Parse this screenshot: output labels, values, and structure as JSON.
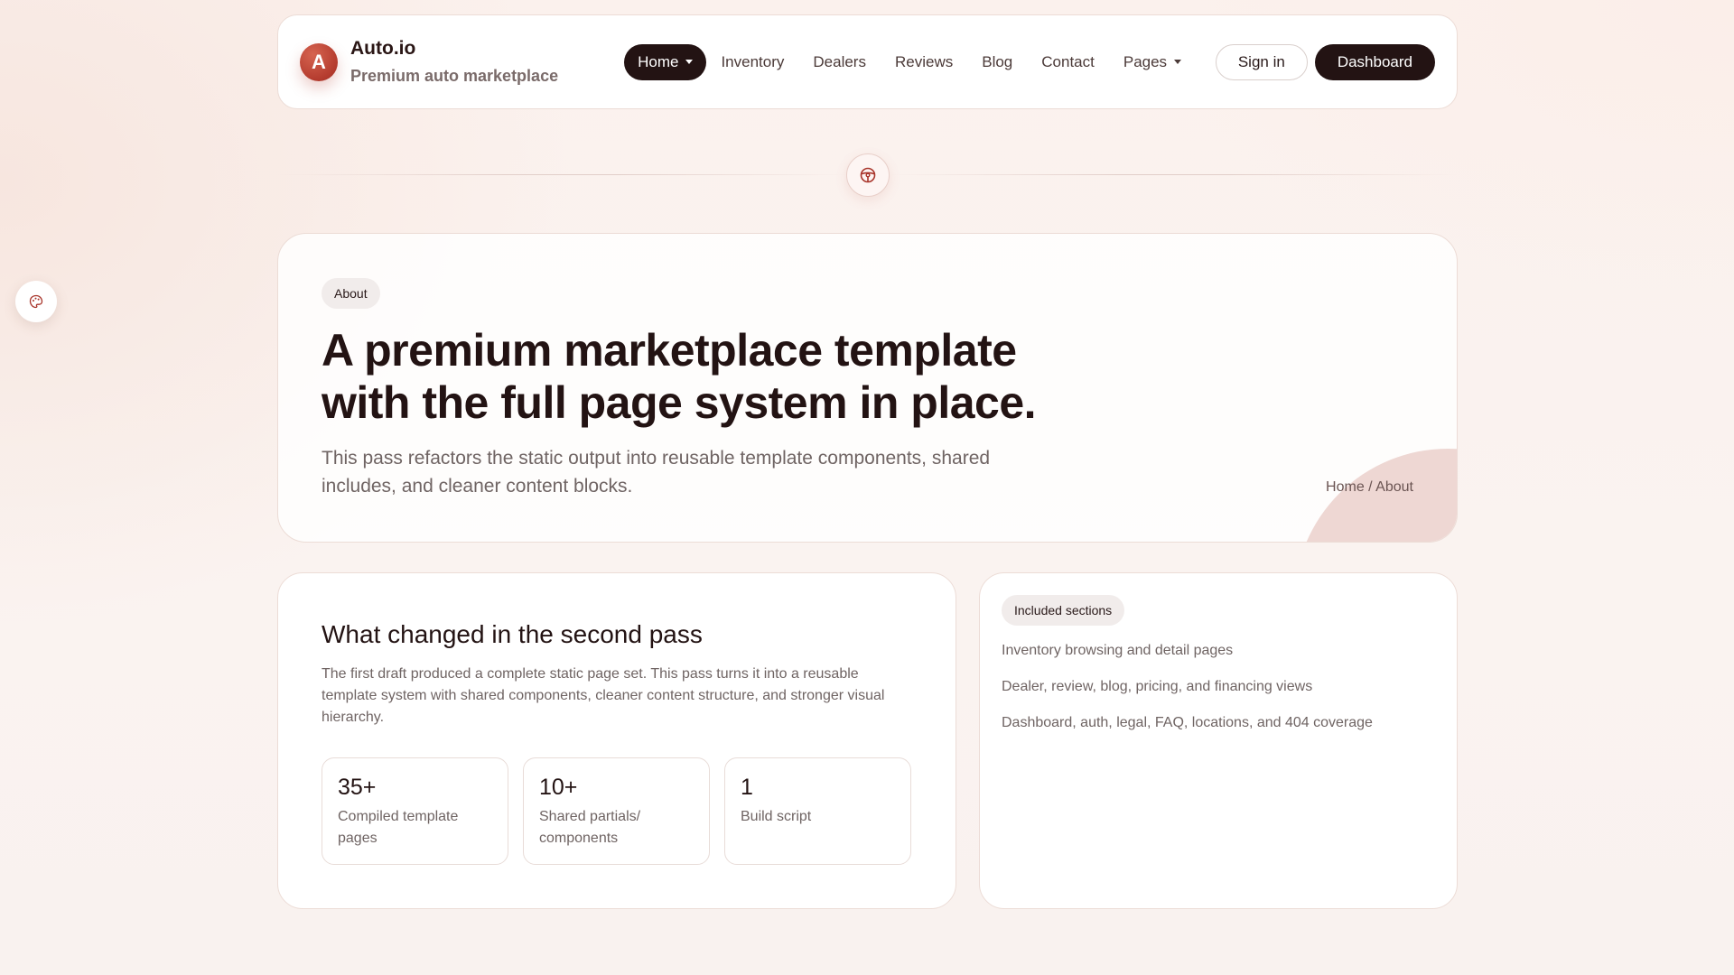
{
  "brand": {
    "initial": "A",
    "name": "Auto.io",
    "tagline": "Premium auto marketplace"
  },
  "nav": {
    "items": [
      {
        "label": "Home",
        "active": true,
        "dropdown": true
      },
      {
        "label": "Inventory"
      },
      {
        "label": "Dealers"
      },
      {
        "label": "Reviews"
      },
      {
        "label": "Blog"
      },
      {
        "label": "Contact"
      },
      {
        "label": "Pages",
        "dropdown": true
      }
    ],
    "sign_in": "Sign in",
    "dashboard": "Dashboard"
  },
  "divider": {
    "icon": "steering-wheel-icon"
  },
  "side_button": {
    "icon": "palette-icon"
  },
  "hero": {
    "badge": "About",
    "title_line1": "A premium marketplace template",
    "title_line2": "with the full page system in place.",
    "subtitle": "This pass refactors the static output into reusable template components, shared includes, and cleaner content blocks.",
    "breadcrumb": "Home / About"
  },
  "changes": {
    "title": "What changed in the second pass",
    "body": "The first draft produced a complete static page set. This pass turns it into a reusable template system with shared components, cleaner content structure, and stronger visual hierarchy.",
    "stats": [
      {
        "value": "35+",
        "label": "Compiled template pages"
      },
      {
        "value": "10+",
        "label": "Shared partials/ components"
      },
      {
        "value": "1",
        "label": "Build script"
      }
    ]
  },
  "included": {
    "badge": "Included sections",
    "items": [
      "Inventory browsing and detail pages",
      "Dealer, review, blog, pricing, and financing views",
      "Dashboard, auth, legal, FAQ, locations, and 404 coverage"
    ]
  },
  "colors": {
    "primary_dark": "#231313",
    "brand_red": "#b43b2e",
    "accent_blob": "#eed7d3"
  }
}
